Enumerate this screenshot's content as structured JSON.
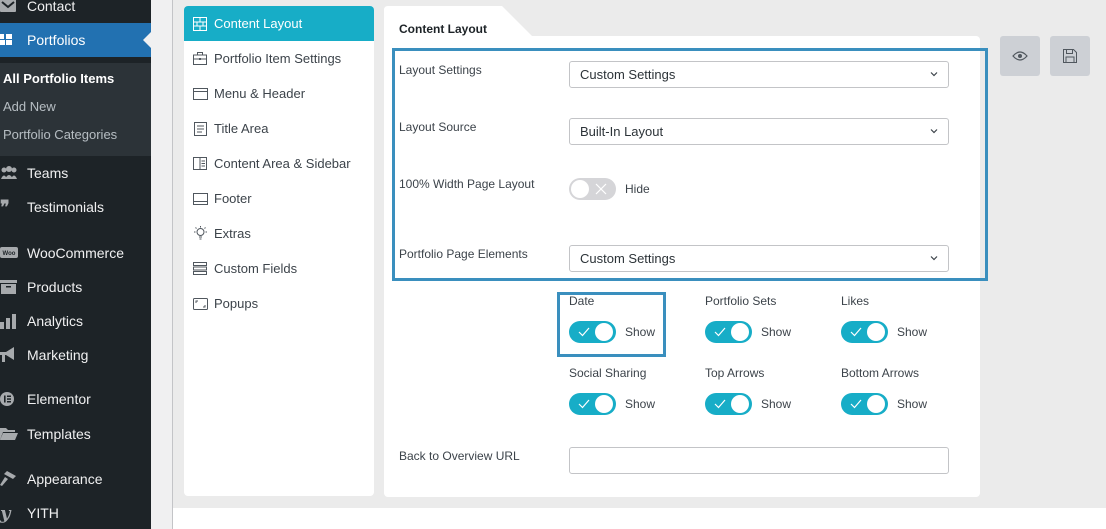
{
  "wp_sidebar": {
    "items": [
      {
        "label": "Contact",
        "icon": "mail-icon"
      },
      {
        "label": "Portfolios",
        "icon": "grid-icon",
        "active": true
      },
      {
        "label": "Teams",
        "icon": "groups-icon"
      },
      {
        "label": "Testimonials",
        "icon": "quote-icon"
      },
      {
        "label": "WooCommerce",
        "icon": "woo-icon"
      },
      {
        "label": "Products",
        "icon": "archive-icon"
      },
      {
        "label": "Analytics",
        "icon": "bar-chart-icon"
      },
      {
        "label": "Marketing",
        "icon": "megaphone-icon"
      },
      {
        "label": "Elementor",
        "icon": "elementor-icon"
      },
      {
        "label": "Templates",
        "icon": "folder-icon"
      },
      {
        "label": "Appearance",
        "icon": "paintbrush-icon"
      },
      {
        "label": "YITH",
        "icon": "yith-icon"
      }
    ],
    "submenu": [
      {
        "label": "All Portfolio Items",
        "current": true
      },
      {
        "label": "Add New"
      },
      {
        "label": "Portfolio Categories"
      }
    ]
  },
  "options_nav": {
    "items": [
      {
        "label": "Content Layout",
        "icon": "layout-grid-icon",
        "active": true
      },
      {
        "label": "Portfolio Item Settings",
        "icon": "briefcase-icon"
      },
      {
        "label": "Menu & Header",
        "icon": "window-icon"
      },
      {
        "label": "Title Area",
        "icon": "title-doc-icon"
      },
      {
        "label": "Content Area & Sidebar",
        "icon": "sidebar-layout-icon"
      },
      {
        "label": "Footer",
        "icon": "footer-icon"
      },
      {
        "label": "Extras",
        "icon": "lightbulb-icon"
      },
      {
        "label": "Custom Fields",
        "icon": "stack-icon"
      },
      {
        "label": "Popups",
        "icon": "popup-icon"
      }
    ]
  },
  "panel": {
    "tab_title": "Content Layout",
    "fields": {
      "layout_settings": {
        "label": "Layout Settings",
        "value": "Custom Settings"
      },
      "layout_source": {
        "label": "Layout Source",
        "value": "Built-In Layout"
      },
      "full_width": {
        "label": "100% Width Page Layout",
        "state": "off",
        "state_label": "Hide"
      },
      "page_elements": {
        "label": "Portfolio Page Elements",
        "value": "Custom Settings"
      },
      "back_url": {
        "label": "Back to Overview URL",
        "value": "",
        "placeholder": ""
      }
    },
    "elements": [
      {
        "label": "Date",
        "state": "on",
        "state_label": "Show"
      },
      {
        "label": "Portfolio Sets",
        "state": "on",
        "state_label": "Show"
      },
      {
        "label": "Likes",
        "state": "on",
        "state_label": "Show"
      },
      {
        "label": "Social Sharing",
        "state": "on",
        "state_label": "Show"
      },
      {
        "label": "Top Arrows",
        "state": "on",
        "state_label": "Show"
      },
      {
        "label": "Bottom Arrows",
        "state": "on",
        "state_label": "Show"
      }
    ]
  },
  "actions": {
    "preview": "eye-icon",
    "save": "floppy-disk-icon"
  },
  "colors": {
    "accent": "#17adc7",
    "wp_active": "#2271b1",
    "highlight": "#3a8fbe",
    "sidebar_bg": "#1d2327"
  }
}
